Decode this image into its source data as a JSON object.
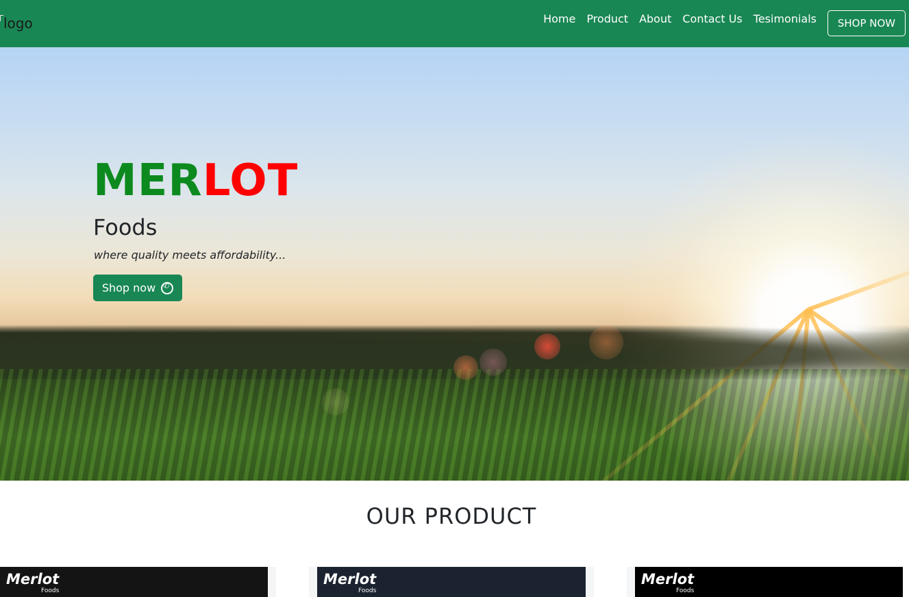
{
  "navbar": {
    "logo_alt": "logo",
    "links": [
      "Home",
      "Product",
      "About",
      "Contact Us",
      "Tesimonials"
    ],
    "cta": "SHOP NOW"
  },
  "hero": {
    "brand_green": "MER",
    "brand_red": "LOT",
    "subtitle": "Foods",
    "tagline": "where quality meets affordability...",
    "button_label": "Shop now",
    "button_icon": "whatsapp-icon"
  },
  "products": {
    "title": "OUR PRODUCT",
    "cards": [
      {
        "logo": "Merlot",
        "logo_sub": "Foods"
      },
      {
        "logo": "Merlot",
        "logo_sub": "Foods"
      },
      {
        "logo": "Merlot",
        "logo_sub": "Foods"
      }
    ]
  },
  "colors": {
    "primary": "#198754",
    "brand_green": "#0c8a1e",
    "brand_red": "#ff0000"
  }
}
